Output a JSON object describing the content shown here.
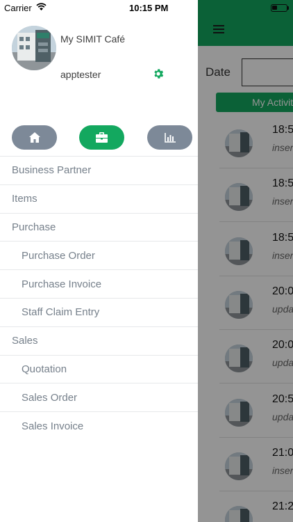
{
  "status_bar": {
    "carrier": "Carrier",
    "time": "10:15 PM"
  },
  "drawer": {
    "company_name": "My SIMIT Café",
    "username": "apptester",
    "quick_buttons": [
      {
        "name": "home",
        "icon": "home-icon",
        "active": false
      },
      {
        "name": "business",
        "icon": "briefcase-icon",
        "active": true
      },
      {
        "name": "reports",
        "icon": "bar-chart-icon",
        "active": false
      }
    ],
    "menu": [
      {
        "label": "Business Partner",
        "level": 0
      },
      {
        "label": "Items",
        "level": 0
      },
      {
        "label": "Purchase",
        "level": 0
      },
      {
        "label": "Purchase Order",
        "level": 1
      },
      {
        "label": "Purchase Invoice",
        "level": 1
      },
      {
        "label": "Staff Claim Entry",
        "level": 1
      },
      {
        "label": "Sales",
        "level": 0
      },
      {
        "label": "Quotation",
        "level": 1
      },
      {
        "label": "Sales Order",
        "level": 1
      },
      {
        "label": "Sales Invoice",
        "level": 1
      }
    ]
  },
  "background": {
    "date_label": "Date",
    "activity_button": "My Activit",
    "rows": [
      {
        "time": "18:5",
        "action": "inser"
      },
      {
        "time": "18:5",
        "action": "inser"
      },
      {
        "time": "18:5",
        "action": "inser"
      },
      {
        "time": "20:0",
        "action": "upda"
      },
      {
        "time": "20:0",
        "action": "upda"
      },
      {
        "time": "20:5",
        "action": "upda"
      },
      {
        "time": "21:0",
        "action": "inser"
      },
      {
        "time": "21:2",
        "action": ""
      }
    ]
  },
  "colors": {
    "accent": "#13a85f",
    "pill_grey": "#7d8998",
    "menu_text": "#76808b"
  }
}
